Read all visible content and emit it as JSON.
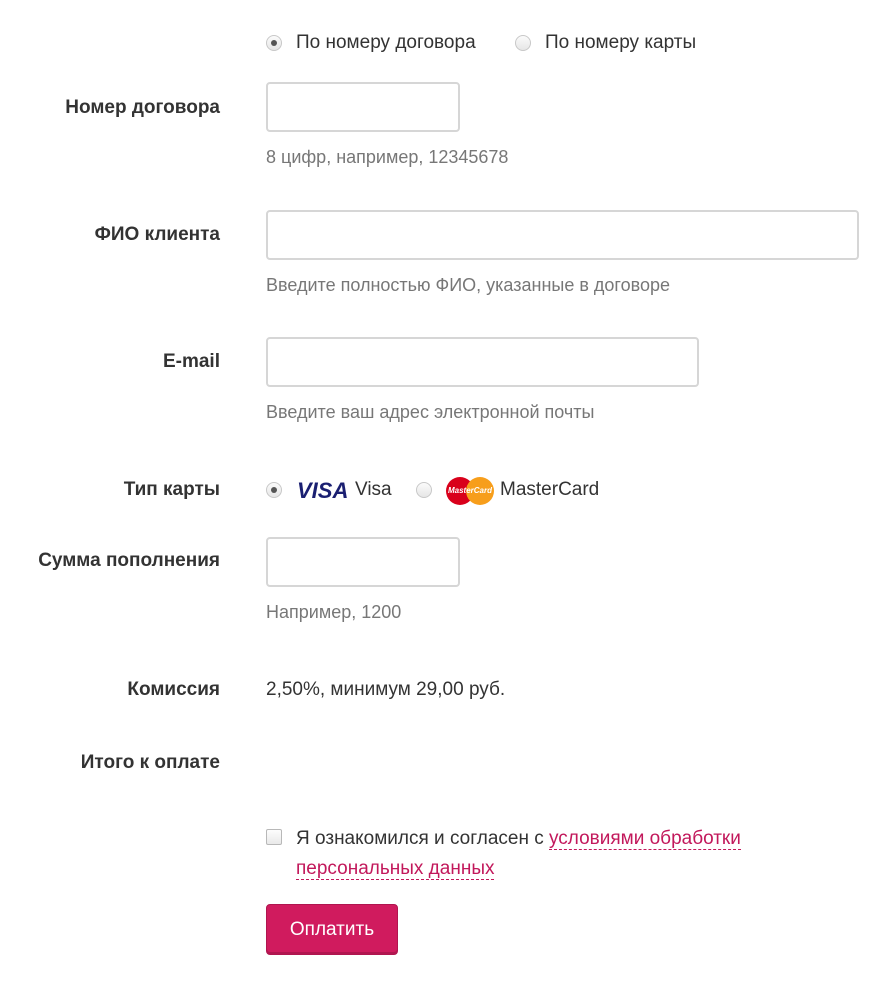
{
  "search_mode": {
    "options": [
      {
        "label": "По номеру договора",
        "selected": true
      },
      {
        "label": "По номеру карты",
        "selected": false
      }
    ]
  },
  "contract": {
    "label": "Номер договора",
    "value": "",
    "hint": "8 цифр, например, 12345678"
  },
  "client_name": {
    "label": "ФИО клиента",
    "value": "",
    "hint": "Введите полностью ФИО, указанные в договоре"
  },
  "email": {
    "label": "E-mail",
    "value": "",
    "hint": "Введите ваш адрес электронной почты"
  },
  "card_type": {
    "label": "Тип карты",
    "options": [
      {
        "logo": "VISA",
        "label": "Visa",
        "selected": true
      },
      {
        "logo": "MasterCard",
        "label": "MasterCard",
        "selected": false
      }
    ]
  },
  "amount": {
    "label": "Сумма пополнения",
    "value": "",
    "hint": "Например, 1200"
  },
  "commission": {
    "label": "Комиссия",
    "value": "2,50%, минимум 29,00 руб."
  },
  "total": {
    "label": "Итого к оплате",
    "value": ""
  },
  "agreement": {
    "checked": false,
    "text": "Я ознакомился и согласен с ",
    "link_text": "условиями обработки персональных данных"
  },
  "submit": {
    "label": "Оплатить"
  },
  "colors": {
    "accent": "#d01b5e",
    "link": "#c2185b",
    "visa_blue": "#1a1f71"
  }
}
